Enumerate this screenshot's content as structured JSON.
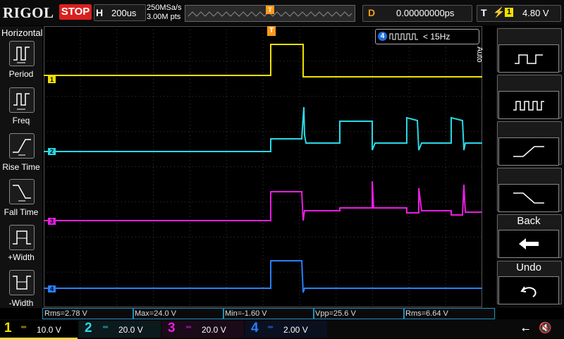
{
  "brand": "RIGOL",
  "run_status": "STOP",
  "horizontal": {
    "label": "H",
    "timebase": "200us",
    "sample_rate": "250MSa/s",
    "mem_depth": "3.00M pts"
  },
  "delay": {
    "label": "D",
    "value": "0.00000000ps"
  },
  "trigger": {
    "label": "T",
    "edge_icon": "rising-edge-icon",
    "channel": "1",
    "level": "4.80 V",
    "marker": "T"
  },
  "left_menu": {
    "title": "Horizontal",
    "items": [
      {
        "label": "Period",
        "icon": "period-icon"
      },
      {
        "label": "Freq",
        "icon": "freq-icon"
      },
      {
        "label": "Rise Time",
        "icon": "rise-time-icon"
      },
      {
        "label": "Fall Time",
        "icon": "fall-time-icon"
      },
      {
        "label": "+Width",
        "icon": "pos-width-icon"
      },
      {
        "label": "-Width",
        "icon": "neg-width-icon"
      }
    ]
  },
  "right_menu": {
    "mode_label": "Auto",
    "back_label": "Back",
    "undo_label": "Undo"
  },
  "freq_counter": {
    "channel": "4",
    "text": "< 15Hz"
  },
  "measurements": [
    {
      "text": "Rms=2.78 V",
      "color": "#f0e000"
    },
    {
      "text": "Max=24.0 V",
      "color": "#f0e000"
    },
    {
      "text": "Min=-1.60 V",
      "color": "#f0e000"
    },
    {
      "text": "Vpp=25.6 V",
      "color": "#f0e000"
    },
    {
      "text": "Rms=6.64 V",
      "color": "#1e8fff"
    }
  ],
  "channels": [
    {
      "num": "1",
      "scale": "10.0 V",
      "color": "#f0e000",
      "marker": "1"
    },
    {
      "num": "2",
      "scale": "20.0 V",
      "color": "#29d9e6",
      "marker": "2"
    },
    {
      "num": "3",
      "scale": "20.0 V",
      "color": "#e81ee0",
      "marker": "3"
    },
    {
      "num": "4",
      "scale": "2.00 V",
      "color": "#2a7fff",
      "marker": "4"
    }
  ],
  "colors": {
    "grid": "#3a3a3a",
    "frame": "#555555",
    "accent": "#ff9a1a"
  }
}
